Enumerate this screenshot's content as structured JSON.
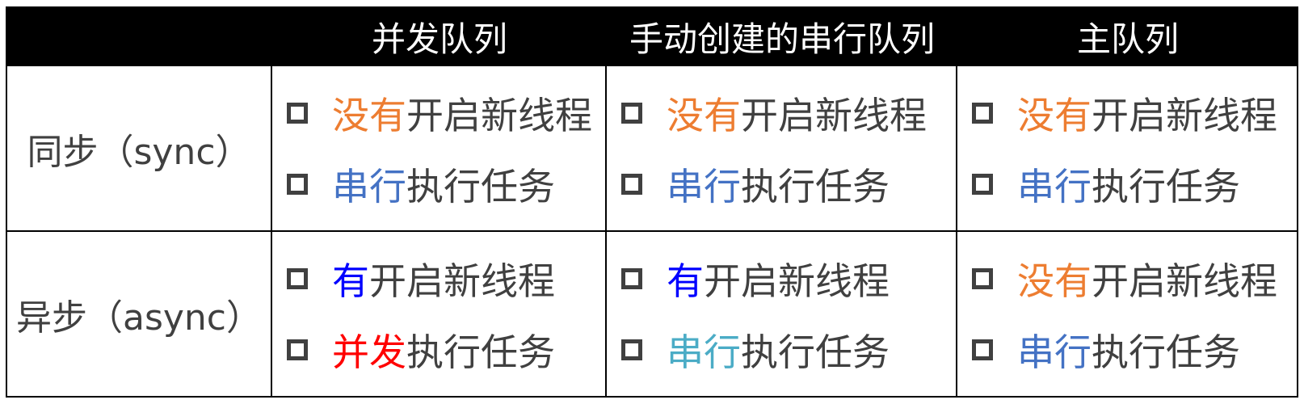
{
  "headers": [
    "",
    "并发队列",
    "手动创建的串行队列",
    "主队列"
  ],
  "rows": [
    {
      "label": "同步（sync）",
      "cells": [
        [
          {
            "hi": "没有",
            "color": "#ED7D31",
            "rest": "开启新线程"
          },
          {
            "hi": "串行",
            "color": "#4472C4",
            "rest": "执行任务"
          }
        ],
        [
          {
            "hi": "没有",
            "color": "#ED7D31",
            "rest": "开启新线程"
          },
          {
            "hi": "串行",
            "color": "#4472C4",
            "rest": "执行任务"
          }
        ],
        [
          {
            "hi": "没有",
            "color": "#ED7D31",
            "rest": "开启新线程"
          },
          {
            "hi": "串行",
            "color": "#4472C4",
            "rest": "执行任务"
          }
        ]
      ]
    },
    {
      "label": "异步（async）",
      "cells": [
        [
          {
            "hi": "有",
            "color": "#0000FF",
            "rest": "开启新线程"
          },
          {
            "hi": "并发",
            "color": "#FF0000",
            "rest": "执行任务"
          }
        ],
        [
          {
            "hi": "有",
            "color": "#0000FF",
            "rest": "开启新线程"
          },
          {
            "hi": "串行",
            "color": "#4BACC6",
            "rest": "执行任务"
          }
        ],
        [
          {
            "hi": "没有",
            "color": "#ED7D31",
            "rest": "开启新线程"
          },
          {
            "hi": "串行",
            "color": "#4472C4",
            "rest": "执行任务"
          }
        ]
      ]
    }
  ]
}
